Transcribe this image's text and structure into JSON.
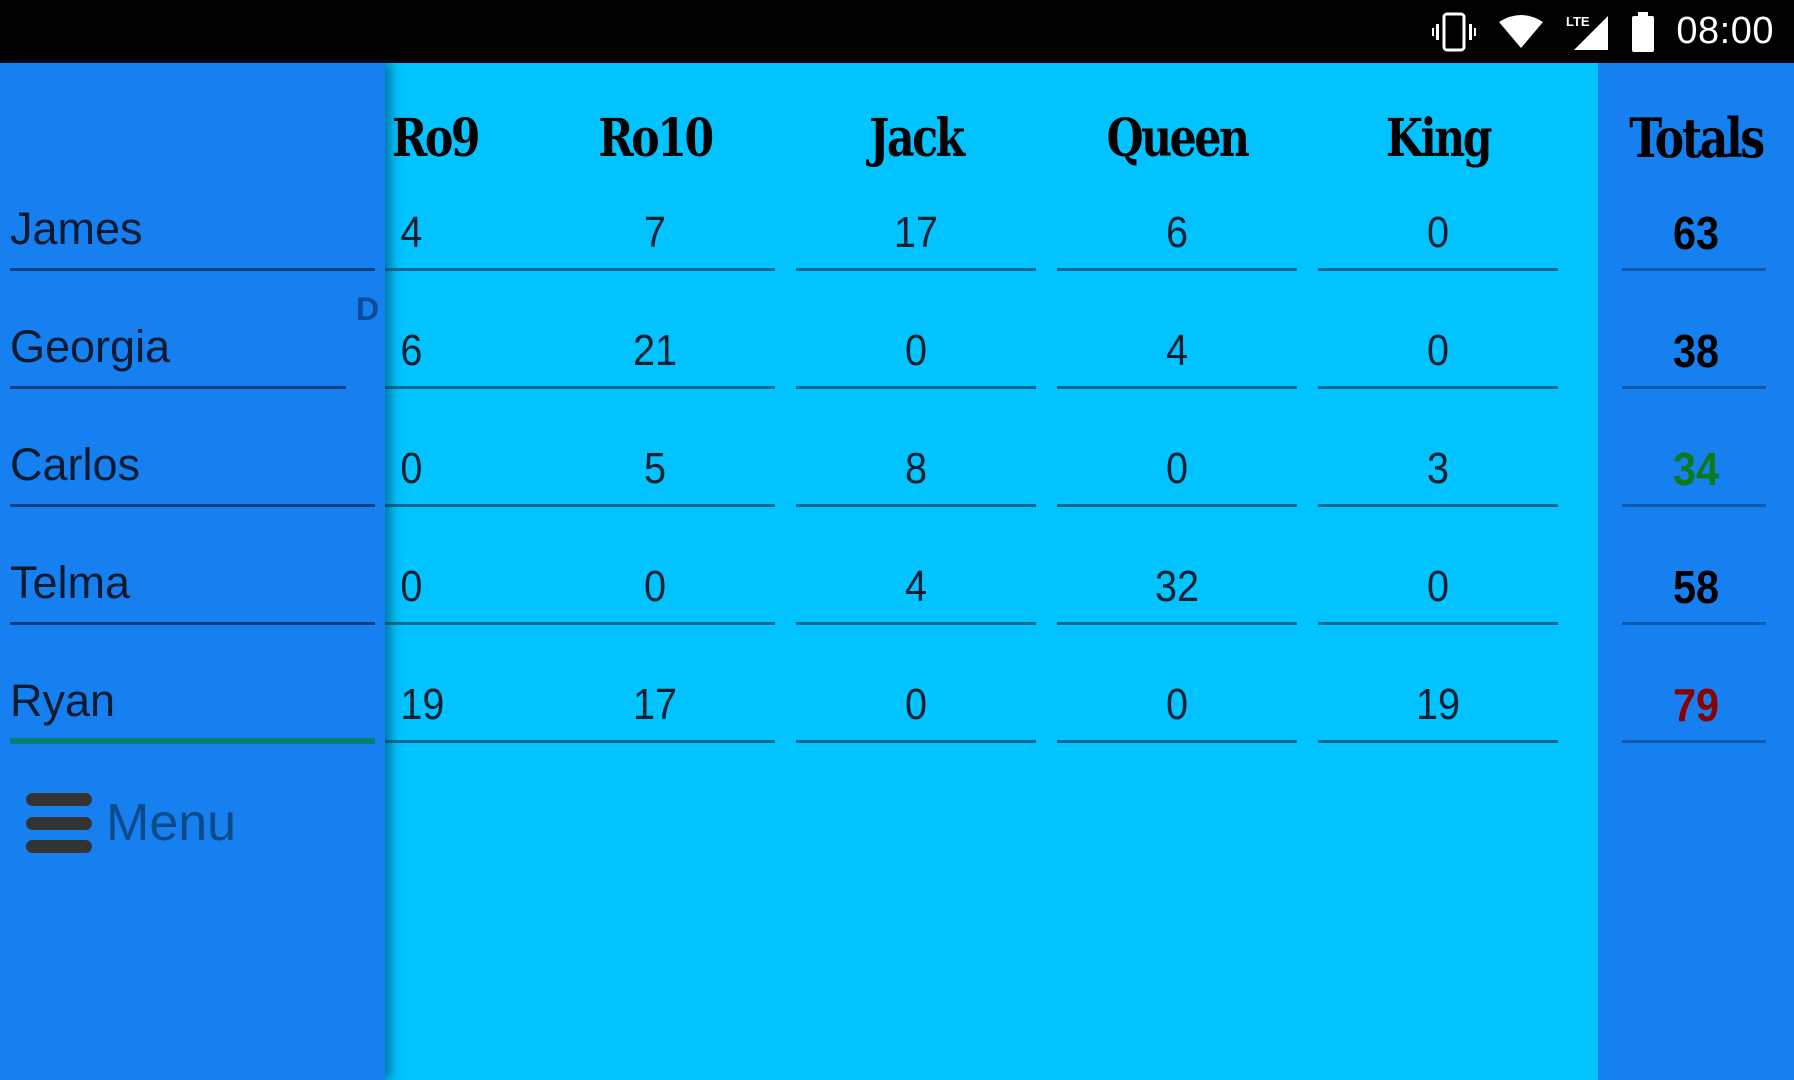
{
  "status_bar": {
    "time": "08:00",
    "icons": [
      "vibrate-icon",
      "wifi-icon",
      "lte-signal-icon",
      "battery-icon"
    ],
    "network_label": "LTE"
  },
  "colors": {
    "panel_blue": "#1780F0",
    "grid_cyan": "#00C3FF",
    "lowest_total": "#0A7A1A",
    "highest_total": "#8B0000",
    "focused_underline": "#08806E"
  },
  "columns": [
    "Ro9",
    "Ro10",
    "Jack",
    "Queen",
    "King"
  ],
  "totals_header": "Totals",
  "dealer_badge": "D",
  "players": [
    {
      "name": "James",
      "scores": [
        "4",
        "7",
        "17",
        "6",
        "0"
      ],
      "total": "63",
      "total_color": "#000000"
    },
    {
      "name": "Georgia",
      "scores": [
        "6",
        "21",
        "0",
        "4",
        "0"
      ],
      "total": "38",
      "total_color": "#000000",
      "dealer": true
    },
    {
      "name": "Carlos",
      "scores": [
        "0",
        "5",
        "8",
        "0",
        "3"
      ],
      "total": "34",
      "total_color": "#0A7A1A"
    },
    {
      "name": "Telma",
      "scores": [
        "0",
        "0",
        "4",
        "32",
        "0"
      ],
      "total": "58",
      "total_color": "#000000"
    },
    {
      "name": "Ryan",
      "scores": [
        "19",
        "17",
        "0",
        "0",
        "19"
      ],
      "total": "79",
      "total_color": "#8B0000",
      "focused": true
    }
  ],
  "menu": {
    "label": "Menu"
  }
}
